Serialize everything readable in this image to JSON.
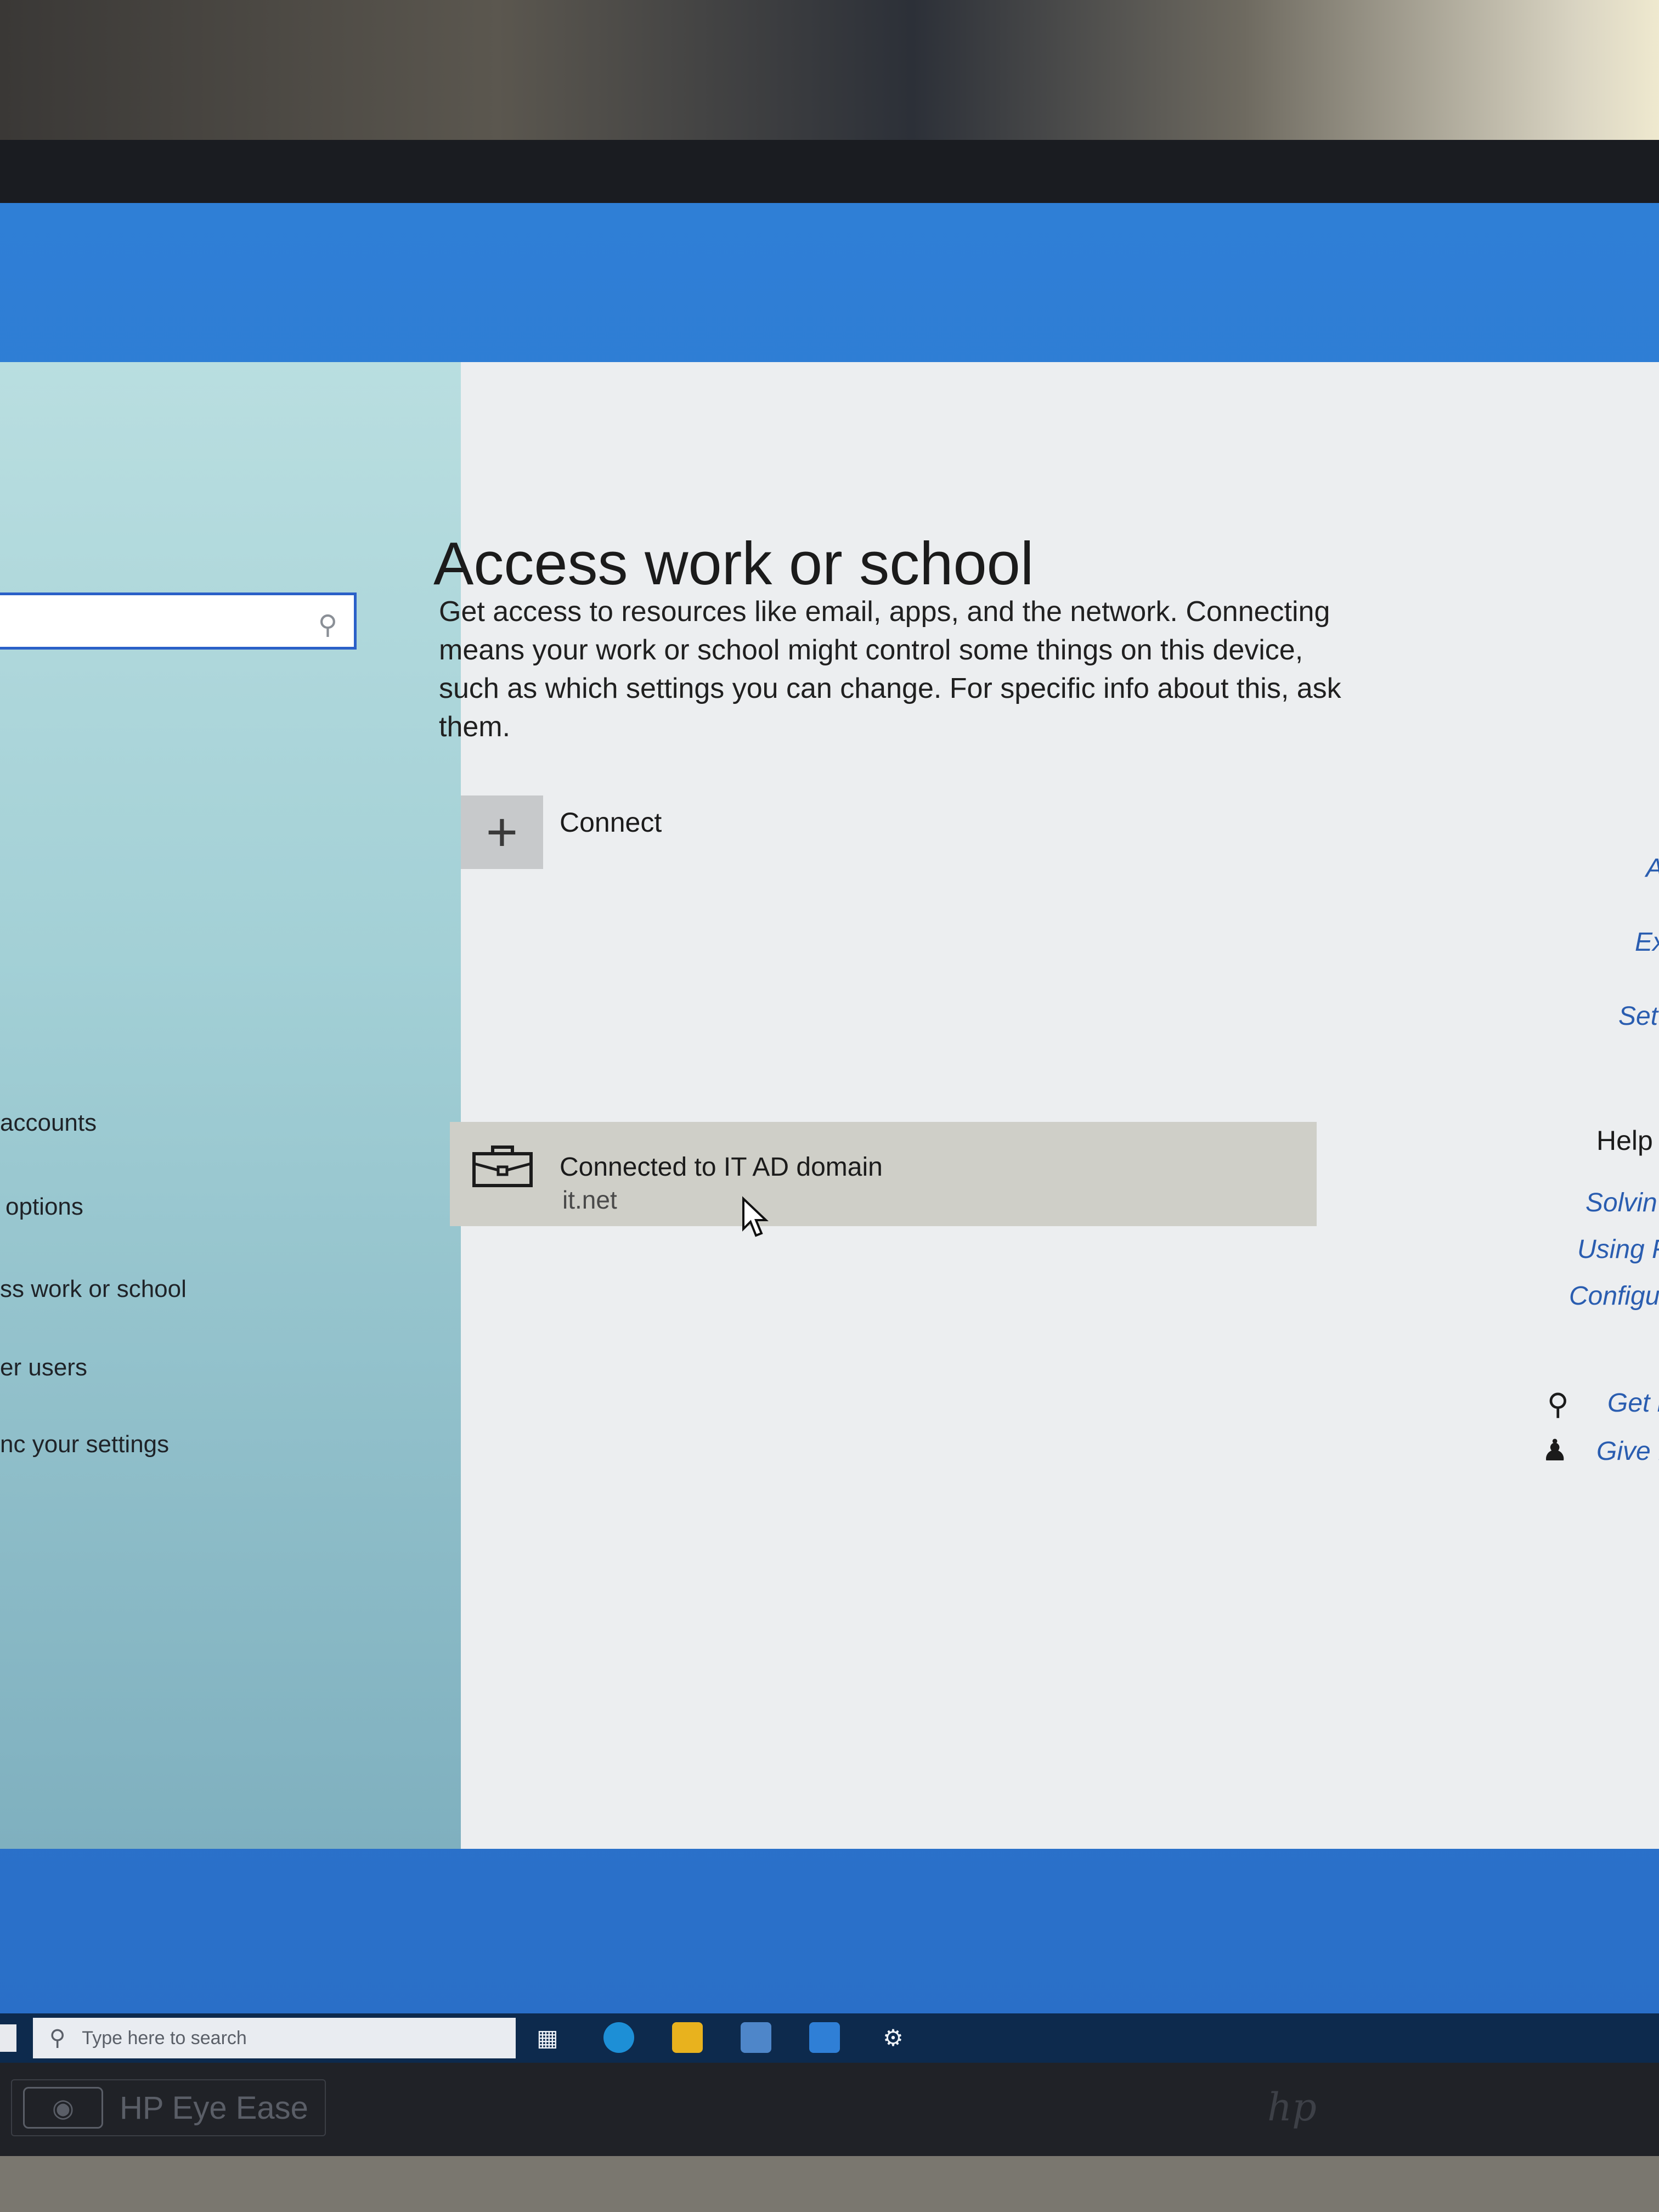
{
  "window": {
    "title": "Access work or school",
    "description": "Get access to resources like email, apps, and the network. Connecting means your work or school might control some things on this device, such as which settings you can change. For specific info about this, ask them."
  },
  "sidebar": {
    "items": [
      {
        "label": "accounts"
      },
      {
        "label": "options"
      },
      {
        "label": "ss work or school"
      },
      {
        "label": "er users"
      },
      {
        "label": "nc your settings"
      }
    ]
  },
  "connect": {
    "label": "Connect",
    "icon": "plus-icon"
  },
  "account": {
    "title": "Connected to IT AD domain",
    "subtitle": "it.net",
    "icon": "briefcase-icon"
  },
  "right_column": {
    "links_top": [
      "A",
      "Ex",
      "Set"
    ],
    "help_heading": "Help",
    "help_links": [
      "Solvin",
      "Using F",
      "Configu"
    ],
    "actions": [
      {
        "label": "Get h",
        "icon": "chat-help-icon"
      },
      {
        "label": "Give f",
        "icon": "feedback-icon"
      }
    ]
  },
  "taskbar": {
    "search_placeholder": "Type here to search",
    "icons": [
      "task-view-icon",
      "edge-icon",
      "file-explorer-icon",
      "store-icon",
      "mail-icon",
      "settings-gear-icon"
    ]
  },
  "monitor": {
    "label": "HP Eye Ease",
    "brand": "hp"
  },
  "colors": {
    "accent": "#2b60c8",
    "link": "#2a5db0",
    "selected_item_bg": "#cfcfc8",
    "taskbar_bg": "#0d2a4d",
    "sidebar_bg": "#a3d0d6"
  }
}
